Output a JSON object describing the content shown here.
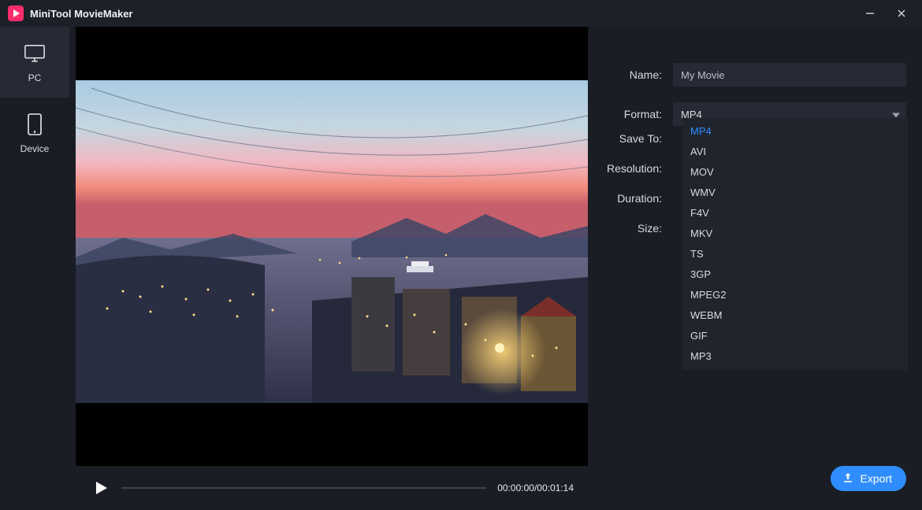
{
  "app": {
    "title": "MiniTool MovieMaker"
  },
  "sidebar": {
    "items": [
      {
        "id": "pc",
        "label": "PC",
        "icon": "monitor-icon",
        "active": true
      },
      {
        "id": "device",
        "label": "Device",
        "icon": "device-icon",
        "active": false
      }
    ]
  },
  "player": {
    "current_time": "00:00:00",
    "total_time": "00:01:14",
    "timecode": "00:00:00/00:01:14"
  },
  "settings": {
    "name_label": "Name:",
    "name_value": "My Movie",
    "format_label": "Format:",
    "format_value": "MP4",
    "saveto_label": "Save To:",
    "resolution_label": "Resolution:",
    "duration_label": "Duration:",
    "size_label": "Size:"
  },
  "format_options": [
    "MP4",
    "AVI",
    "MOV",
    "WMV",
    "F4V",
    "MKV",
    "TS",
    "3GP",
    "MPEG2",
    "WEBM",
    "GIF",
    "MP3"
  ],
  "format_selected": "MP4",
  "export": {
    "label": "Export"
  }
}
